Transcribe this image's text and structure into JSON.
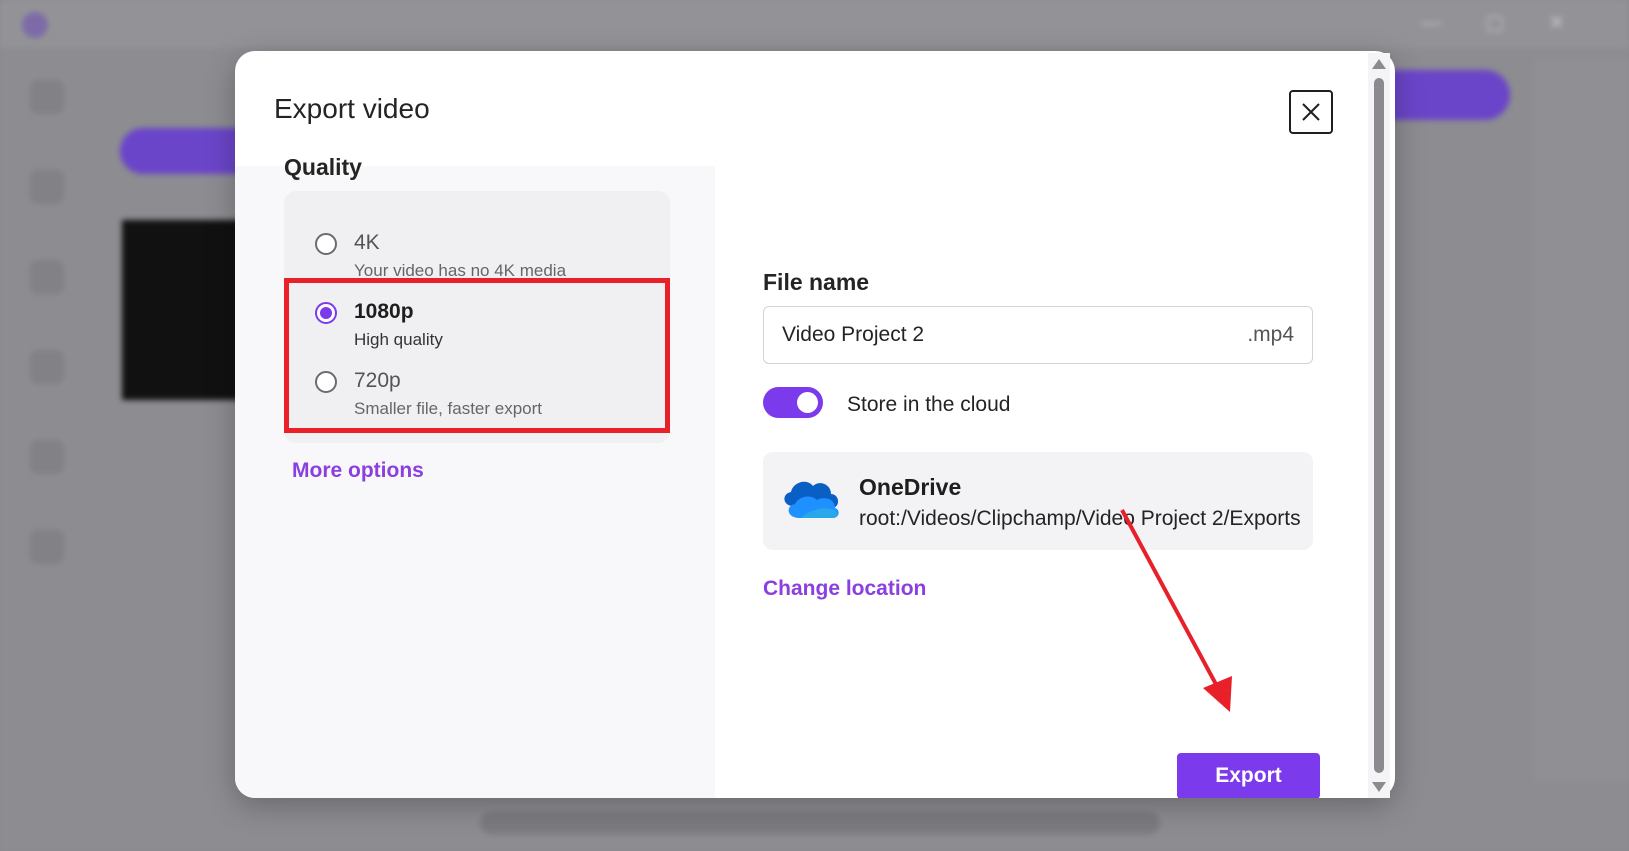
{
  "dialog": {
    "title": "Export video",
    "close_icon": "close-icon"
  },
  "quality": {
    "label": "Quality",
    "options": [
      {
        "title": "4K",
        "subtitle": "Your video has no 4K media",
        "selected": false
      },
      {
        "title": "1080p",
        "subtitle": "High quality",
        "selected": true
      },
      {
        "title": "720p",
        "subtitle": "Smaller file, faster export",
        "selected": false
      }
    ],
    "more_options": "More options"
  },
  "file": {
    "label": "File name",
    "value": "Video Project 2",
    "extension": ".mp4"
  },
  "cloud": {
    "toggle_label": "Store in the cloud",
    "toggle_on": true,
    "provider": "OneDrive",
    "provider_icon": "onedrive-cloud-icon",
    "path": "root:/Videos/Clipchamp/Video Project 2/Exports",
    "change_location": "Change location"
  },
  "actions": {
    "export_label": "Export"
  },
  "colors": {
    "accent": "#7c3aed",
    "annotation": "#e8202a"
  }
}
